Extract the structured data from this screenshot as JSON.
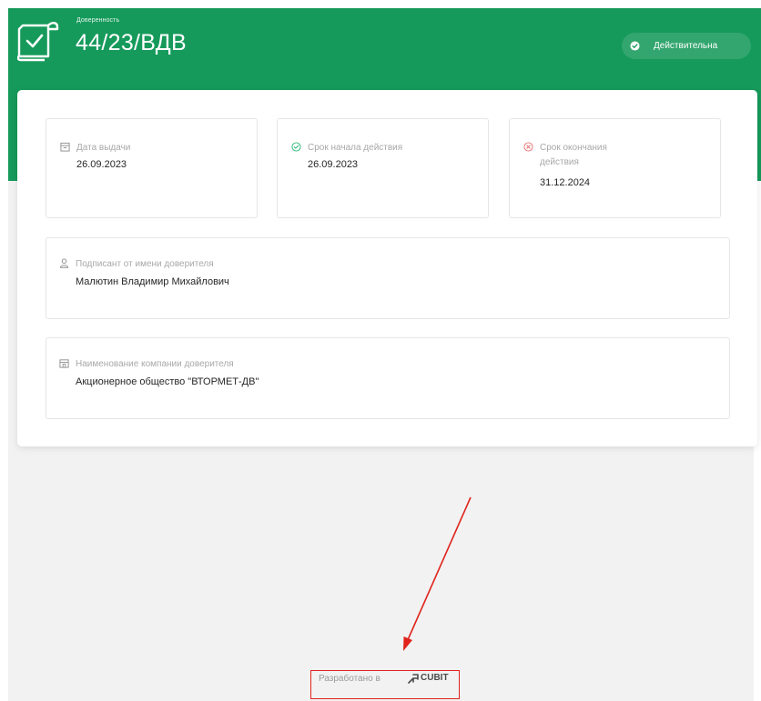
{
  "header": {
    "caption": "Доверенность",
    "title": "44/23/ВДВ",
    "status_label": "Действительна",
    "accent_color": "#169a5b",
    "icon": "document-check-icon",
    "status_icon": "check-circle-icon"
  },
  "fields": {
    "issue_date": {
      "label": "Дата выдачи",
      "value": "26.09.2023",
      "icon": "calendar-icon"
    },
    "start_date": {
      "label": "Срок начала действия",
      "value": "26.09.2023",
      "icon": "check-circle-icon",
      "icon_color": "#2bb673"
    },
    "end_date": {
      "label_line1": "Срок окончания",
      "label_line2": "действия",
      "value": "31.12.2024",
      "icon": "x-circle-icon",
      "icon_color": "#e57373"
    },
    "signer": {
      "label": "Подписант от имени доверителя",
      "value": "Малютин Владимир Михайлович",
      "icon": "user-icon"
    },
    "company": {
      "label": "Наименование компании доверителя",
      "value": "Акционерное общество \"ВТОРМЕТ-ДВ\"",
      "icon": "building-icon"
    }
  },
  "footer": {
    "text": "Разработано в",
    "brand": "CUBIT",
    "logo_icon": "cubit-logo-icon",
    "highlight_color": "#e0231c"
  }
}
